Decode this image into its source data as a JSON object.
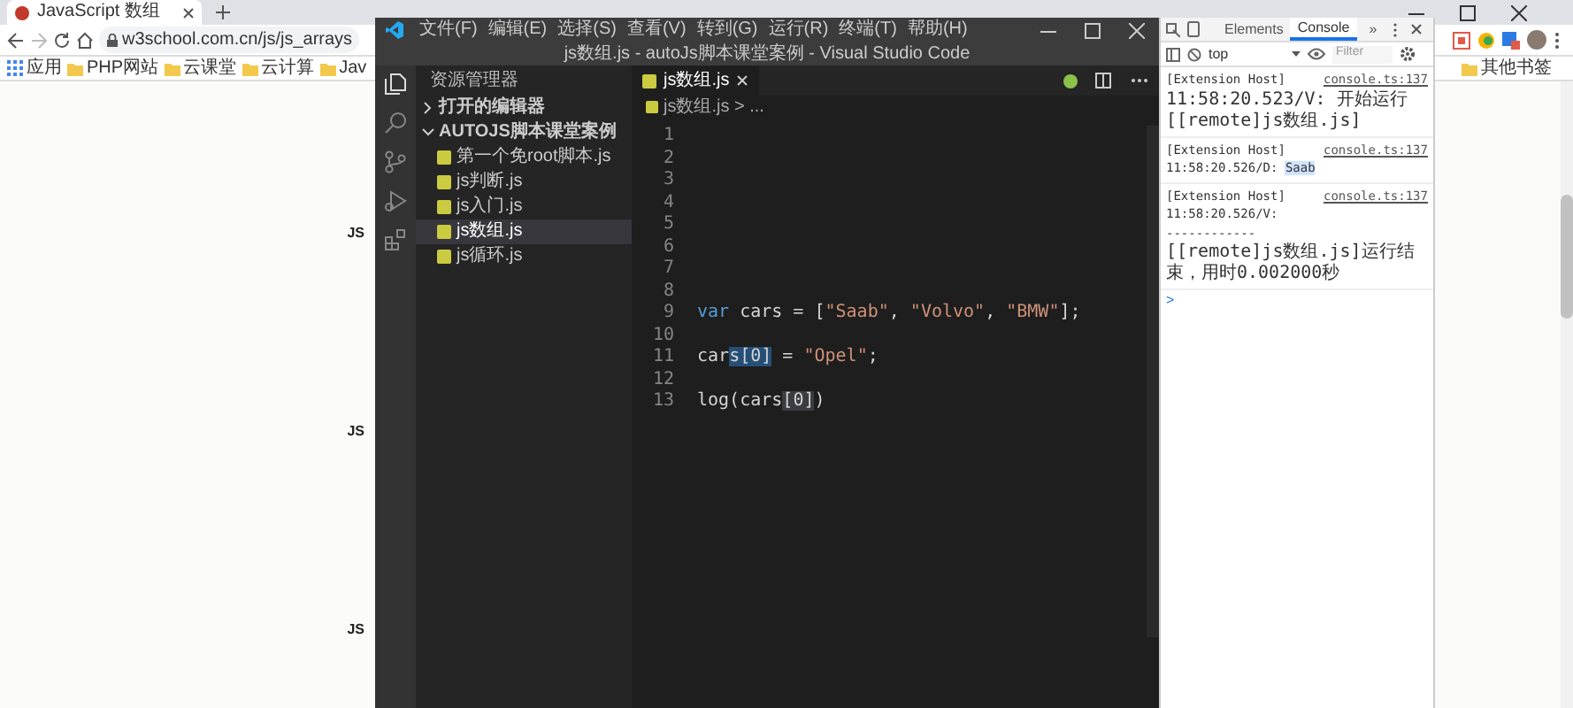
{
  "browser": {
    "tab_title": "JavaScript 数组",
    "address": "w3school.com.cn/js/js_arrays",
    "bookmarks": [
      {
        "kind": "apps",
        "label": "应用"
      },
      {
        "kind": "folder",
        "label": "PHP网站"
      },
      {
        "kind": "folder",
        "label": "云课堂"
      },
      {
        "kind": "folder",
        "label": "云计算"
      },
      {
        "kind": "folder",
        "label": "Jav"
      }
    ],
    "other_bookmarks": "其他书签",
    "page_marks": [
      "JS",
      "JS",
      "JS"
    ]
  },
  "editor_window": {
    "menu": [
      "文件(F)",
      "编辑(E)",
      "选择(S)",
      "查看(V)",
      "转到(G)",
      "运行(R)",
      "终端(T)",
      "帮助(H)"
    ],
    "title": "js数组.js - autoJs脚本课堂案例 - Visual Studio Code",
    "explorer_title": "资源管理器",
    "sections": [
      {
        "label": "打开的编辑器",
        "expanded": false
      },
      {
        "label": "AUTOJS脚本课堂案例",
        "expanded": true,
        "children": [
          {
            "name": "第一个免root脚本.js",
            "selected": false
          },
          {
            "name": "js判断.js",
            "selected": false
          },
          {
            "name": "js入门.js",
            "selected": false
          },
          {
            "name": "js数组.js",
            "selected": true
          },
          {
            "name": "js循环.js",
            "selected": false
          }
        ]
      }
    ],
    "tab": "js数组.js",
    "breadcrumb": "js数组.js > ...",
    "lines": [
      {
        "number": "1"
      },
      {
        "number": "2"
      },
      {
        "number": "3"
      },
      {
        "number": "4"
      },
      {
        "number": "5"
      },
      {
        "number": "6"
      },
      {
        "number": "7"
      },
      {
        "number": "8"
      },
      {
        "number": "9",
        "tokens": [
          {
            "kind": "keyword",
            "text": "var"
          },
          {
            "kind": "plain",
            "text": " cars = ["
          },
          {
            "kind": "string",
            "text": "\"Saab\""
          },
          {
            "kind": "plain",
            "text": ", "
          },
          {
            "kind": "string",
            "text": "\"Volvo\""
          },
          {
            "kind": "plain",
            "text": ", "
          },
          {
            "kind": "string",
            "text": "\"BMW\""
          },
          {
            "kind": "plain",
            "text": "];"
          }
        ]
      },
      {
        "number": "10"
      },
      {
        "number": "11",
        "tokens": [
          {
            "kind": "plain",
            "text": "car"
          },
          {
            "kind": "selection",
            "text": "s[0]"
          },
          {
            "kind": "plain",
            "text": " = "
          },
          {
            "kind": "string",
            "text": "\"Opel\""
          },
          {
            "kind": "plain",
            "text": ";"
          }
        ]
      },
      {
        "number": "12"
      },
      {
        "number": "13",
        "tokens": [
          {
            "kind": "plain",
            "text": "log(cars"
          },
          {
            "kind": "match",
            "text": "[0]"
          },
          {
            "kind": "plain",
            "text": ")"
          }
        ]
      }
    ]
  },
  "devtools": {
    "tabs": [
      {
        "label": "Elements",
        "selected": false
      },
      {
        "label": "Console",
        "selected": true
      }
    ],
    "more": "»",
    "context": "top",
    "filter_placeholder": "Filter",
    "messages": [
      {
        "source": "[Extension Host]",
        "link": "console.ts:137",
        "lines": [
          [
            {
              "text": "11:58:20.523/V: 开始运行[[remote]js数组.js]",
              "highlight": false
            }
          ]
        ]
      },
      {
        "source": "[Extension Host]",
        "link": "console.ts:137",
        "lines": [
          [
            {
              "text": "11:58:20.526/D: ",
              "highlight": false
            },
            {
              "text": "Saab",
              "highlight": true
            }
          ]
        ]
      },
      {
        "source": "[Extension Host]",
        "link": "console.ts:137",
        "lines": [
          [
            {
              "text": "11:58:20.526/V:",
              "highlight": false
            }
          ],
          [
            {
              "text": "------------",
              "highlight": false
            }
          ],
          [
            {
              "text": "[[remote]js数组.js]运行结束，用时0.002000秒",
              "highlight": false
            }
          ]
        ]
      }
    ],
    "prompt": ">"
  }
}
